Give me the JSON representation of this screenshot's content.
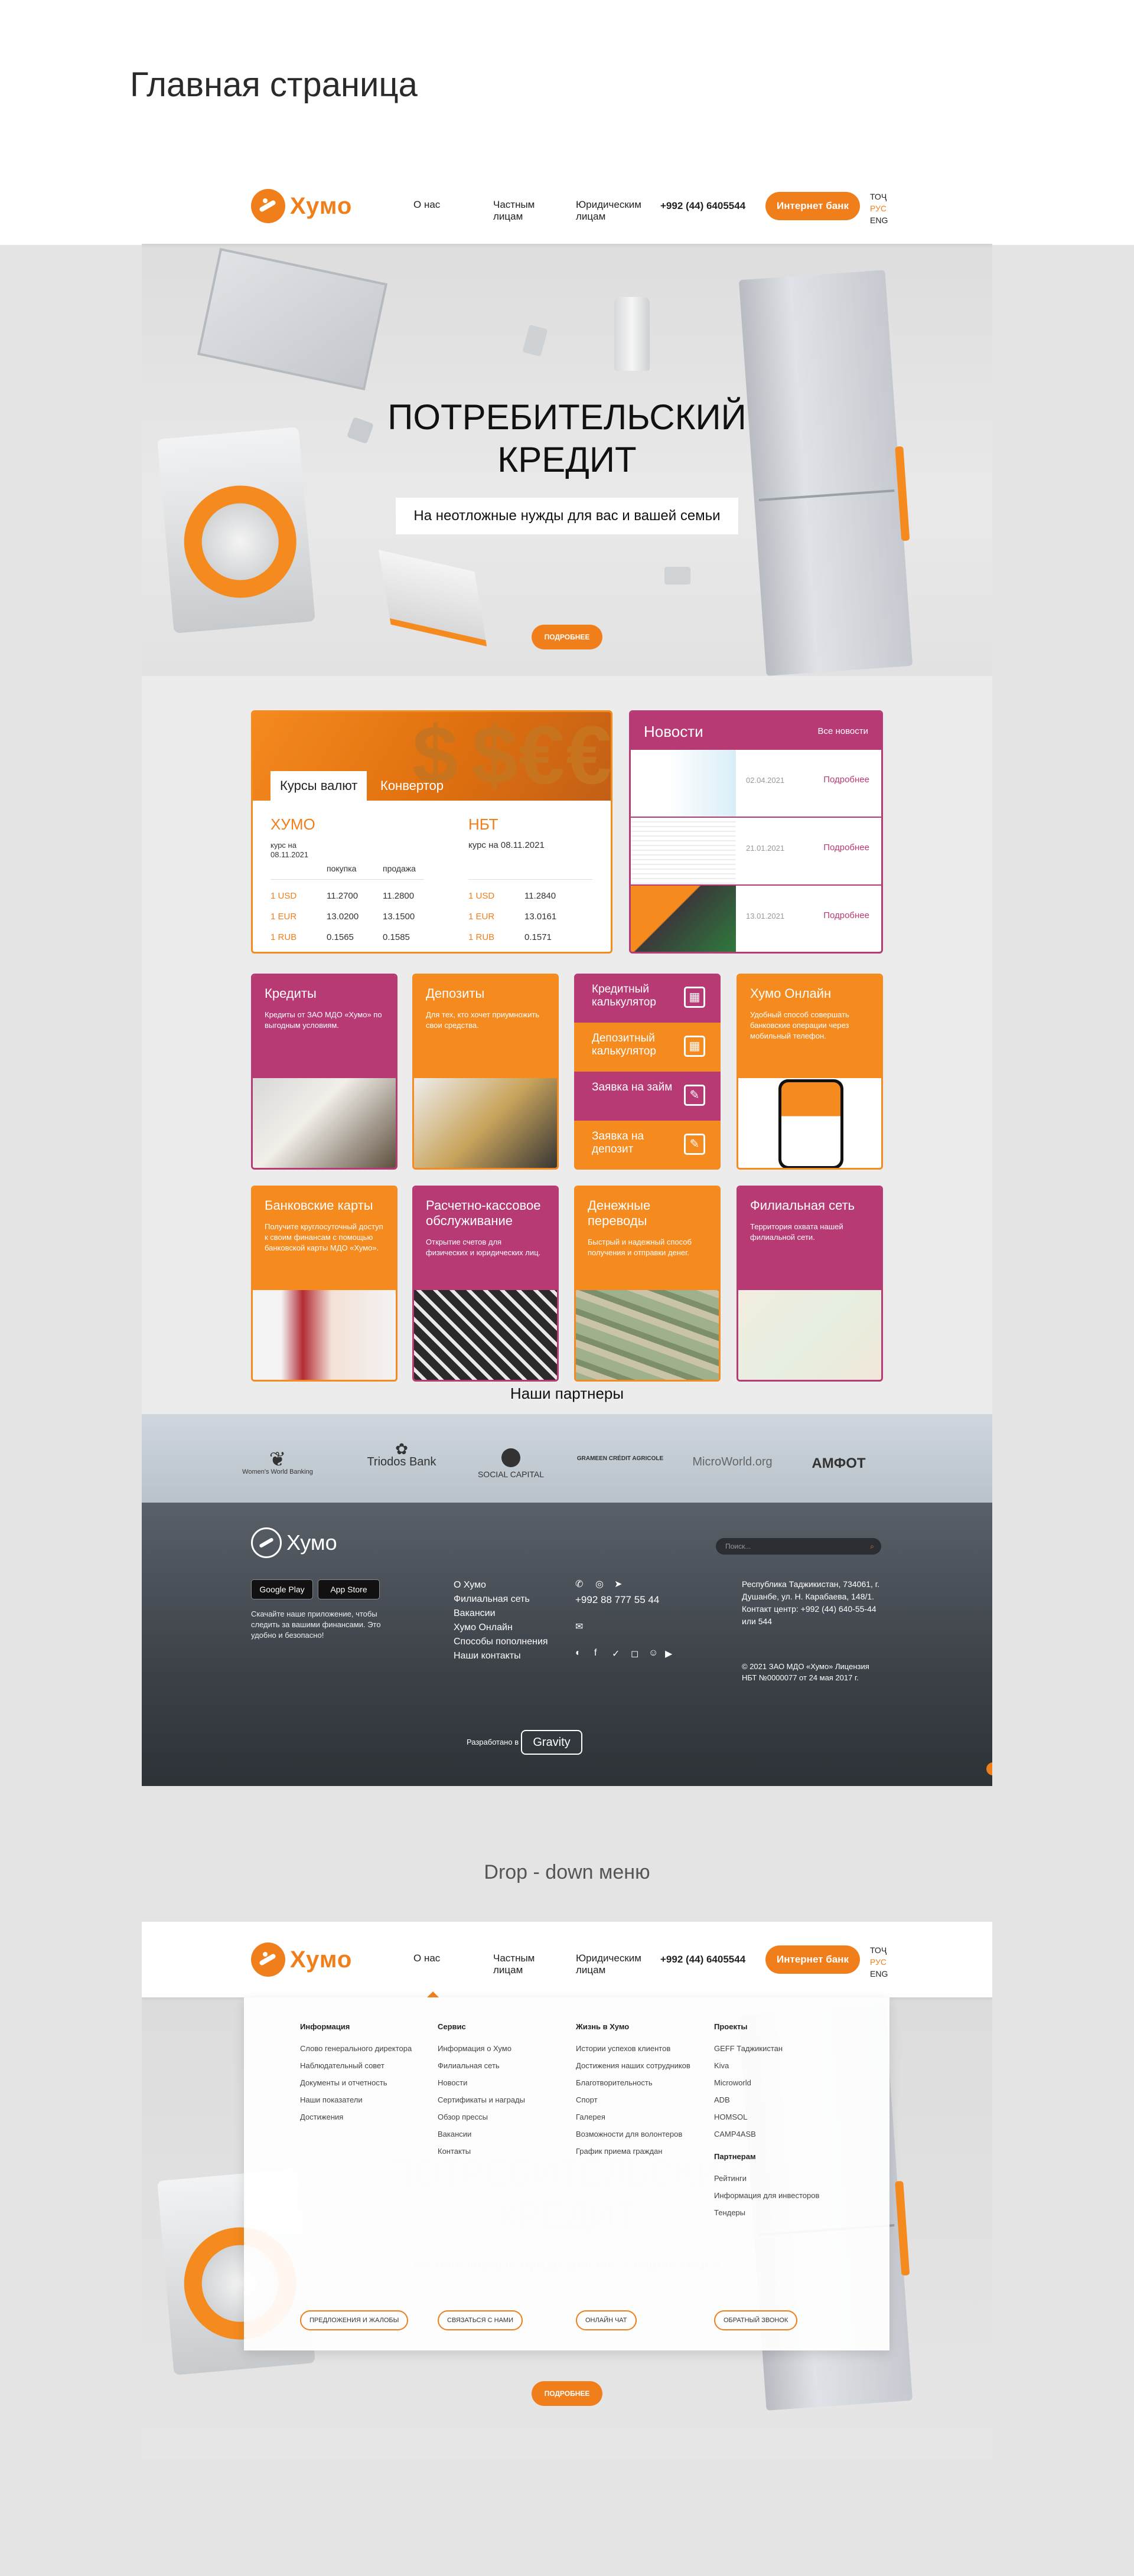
{
  "page_title": "Главная страница",
  "dropdown_title": "Drop - down меню",
  "header": {
    "logo": "Хумо",
    "nav": [
      "О нас",
      "Частным лицам",
      "Юридическим лицам"
    ],
    "phone": "+992 (44) 6405544",
    "ibank": "Интернет банк",
    "langs": [
      "ТОҶ",
      "РУС",
      "ENG"
    ]
  },
  "hero": {
    "title": "ПОТРЕБИТЕЛЬСКИЙ КРЕДИТ",
    "subtitle": "На неотложные нужды для вас и вашей семьи",
    "more": "ПОДРОБНЕЕ"
  },
  "rates": {
    "tab_active": "Курсы валют",
    "tab_inactive": "Конвертор",
    "humo": {
      "title": "ХУМО",
      "date": "курс на 08.11.2021",
      "col_buy": "покупка",
      "col_sell": "продажа",
      "rows": [
        {
          "cur": "1 USD",
          "buy": "11.2700",
          "sell": "11.2800"
        },
        {
          "cur": "1 EUR",
          "buy": "13.0200",
          "sell": "13.1500"
        },
        {
          "cur": "1 RUB",
          "buy": "0.1565",
          "sell": "0.1585"
        }
      ]
    },
    "nbt": {
      "title": "НБТ",
      "date": "курс на 08.11.2021",
      "rows": [
        {
          "cur": "1 USD",
          "val": "11.2840"
        },
        {
          "cur": "1 EUR",
          "val": "13.0161"
        },
        {
          "cur": "1 RUB",
          "val": "0.1571"
        }
      ]
    }
  },
  "news": {
    "title": "Новости",
    "all": "Все новости",
    "items": [
      {
        "date": "02.04.2021",
        "more": "Подробнее"
      },
      {
        "date": "21.01.2021",
        "more": "Подробнее"
      },
      {
        "date": "13.01.2021",
        "more": "Подробнее"
      }
    ]
  },
  "cards_row1": [
    {
      "title": "Кредиты",
      "desc": "Кредиты от ЗАО МДО «Хумо» по выгодным условиям."
    },
    {
      "title": "Депозиты",
      "desc": "Для тех, кто хочет приумножить свои средства."
    }
  ],
  "calc": [
    {
      "label": "Кредитный калькулятор",
      "icon": "calculator-icon"
    },
    {
      "label": "Депозитный калькулятор",
      "icon": "calculator-icon"
    },
    {
      "label": "Заявка на займ",
      "icon": "edit-icon"
    },
    {
      "label": "Заявка на депозит",
      "icon": "edit-icon"
    }
  ],
  "humo_online": {
    "title": "Хумо Онлайн",
    "desc": "Удобный способ совершать банковские операции через мобильный телефон."
  },
  "cards_row2": [
    {
      "title": "Банковские карты",
      "desc": "Получите круглосуточный доступ к своим финансам с помощью банковской карты МДО «Хумо»."
    },
    {
      "title": "Расчетно-кассовое обслуживание",
      "desc": "Открытие счетов для физических и юридических лиц."
    },
    {
      "title": "Денежные переводы",
      "desc": "Быстрый и надежный способ получения и отправки денег."
    },
    {
      "title": "Филиальная сеть",
      "desc": "Территория охвата нашей филиальной сети."
    }
  ],
  "partners": {
    "title": "Наши партнеры",
    "logos": [
      "Women's World Banking",
      "Triodos Bank",
      "SOCIAL CAPITAL",
      "GRAMEEN CRÉDIT AGRICOLE",
      "MicroWorld.org",
      "АМФОТ"
    ]
  },
  "footer": {
    "logo": "Хумо",
    "google": "Google Play",
    "appstore": "App Store",
    "desc": "Скачайте наше приложение, чтобы следить за вашими финансами. Это удобно и безопасно!",
    "menu": [
      "О Хумо",
      "Филиальная сеть",
      "Вакансии",
      "Хумо Онлайн",
      "Способы пополнения",
      "Наши контакты"
    ],
    "phone": "+992 88 777 55 44",
    "search_placeholder": "Поиск...",
    "address": "Республика Таджикистан, 734061, г. Душанбе, ул. Н. Карабаева, 148/1.",
    "contact": "Контакт центр: +992 (44) 640-55-44 или 544",
    "copyright": "© 2021 ЗАО МДО «Хумо» Лицензия НБТ №0000077 от 24 мая 2017 г.",
    "dev": "Разработано в",
    "gravity": "Gravity"
  },
  "dropdown": {
    "columns": [
      {
        "head": "Информация",
        "items": [
          "Слово генерального директора",
          "Наблюдательный совет",
          "Документы и отчетность",
          "Наши показатели",
          "Достижения"
        ]
      },
      {
        "head": "Сервис",
        "items": [
          "Информация о Хумо",
          "Филиальная сеть",
          "Новости",
          "Сертификаты и награды",
          "Обзор прессы",
          "Вакансии",
          "Контакты"
        ]
      },
      {
        "head": "Жизнь в Хумо",
        "items": [
          "Истории успехов клиентов",
          "Достижения наших сотрудников",
          "Благотворительность",
          "Спорт",
          "Галерея",
          "Возможности для волонтеров",
          "График приема граждан"
        ]
      },
      {
        "head": "Проекты",
        "items": [
          "GEFF Таджикистан",
          "Kiva",
          "Microworld",
          "ADB",
          "HOMSOL",
          "CAMP4ASB"
        ]
      }
    ],
    "partners_head": "Партнерам",
    "partners_items": [
      "Рейтинги",
      "Информация для инвесторов",
      "Тендеры"
    ],
    "buttons": [
      "ПРЕДЛОЖЕНИЯ И ЖАЛОБЫ",
      "СВЯЗАТЬСЯ С НАМИ",
      "ОНЛАЙН ЧАТ",
      "ОБРАТНЫЙ ЗВОНОК"
    ]
  }
}
